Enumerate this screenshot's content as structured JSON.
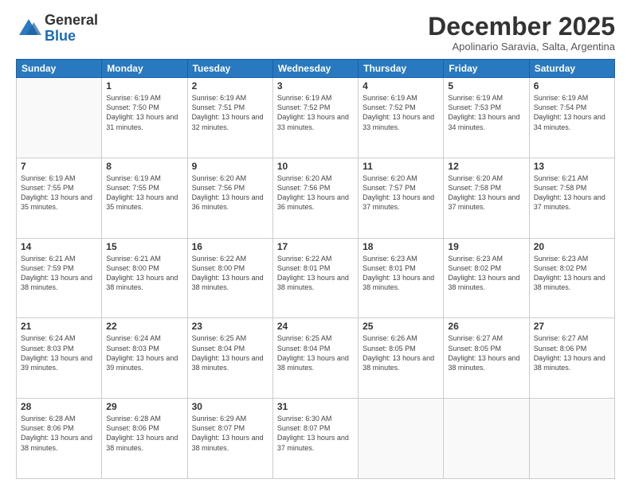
{
  "logo": {
    "general": "General",
    "blue": "Blue"
  },
  "title": "December 2025",
  "subtitle": "Apolinario Saravia, Salta, Argentina",
  "days_of_week": [
    "Sunday",
    "Monday",
    "Tuesday",
    "Wednesday",
    "Thursday",
    "Friday",
    "Saturday"
  ],
  "weeks": [
    [
      {
        "day": "",
        "info": ""
      },
      {
        "day": "1",
        "info": "Sunrise: 6:19 AM\nSunset: 7:50 PM\nDaylight: 13 hours and 31 minutes."
      },
      {
        "day": "2",
        "info": "Sunrise: 6:19 AM\nSunset: 7:51 PM\nDaylight: 13 hours and 32 minutes."
      },
      {
        "day": "3",
        "info": "Sunrise: 6:19 AM\nSunset: 7:52 PM\nDaylight: 13 hours and 33 minutes."
      },
      {
        "day": "4",
        "info": "Sunrise: 6:19 AM\nSunset: 7:52 PM\nDaylight: 13 hours and 33 minutes."
      },
      {
        "day": "5",
        "info": "Sunrise: 6:19 AM\nSunset: 7:53 PM\nDaylight: 13 hours and 34 minutes."
      },
      {
        "day": "6",
        "info": "Sunrise: 6:19 AM\nSunset: 7:54 PM\nDaylight: 13 hours and 34 minutes."
      }
    ],
    [
      {
        "day": "7",
        "info": "Sunrise: 6:19 AM\nSunset: 7:55 PM\nDaylight: 13 hours and 35 minutes."
      },
      {
        "day": "8",
        "info": "Sunrise: 6:19 AM\nSunset: 7:55 PM\nDaylight: 13 hours and 35 minutes."
      },
      {
        "day": "9",
        "info": "Sunrise: 6:20 AM\nSunset: 7:56 PM\nDaylight: 13 hours and 36 minutes."
      },
      {
        "day": "10",
        "info": "Sunrise: 6:20 AM\nSunset: 7:56 PM\nDaylight: 13 hours and 36 minutes."
      },
      {
        "day": "11",
        "info": "Sunrise: 6:20 AM\nSunset: 7:57 PM\nDaylight: 13 hours and 37 minutes."
      },
      {
        "day": "12",
        "info": "Sunrise: 6:20 AM\nSunset: 7:58 PM\nDaylight: 13 hours and 37 minutes."
      },
      {
        "day": "13",
        "info": "Sunrise: 6:21 AM\nSunset: 7:58 PM\nDaylight: 13 hours and 37 minutes."
      }
    ],
    [
      {
        "day": "14",
        "info": "Sunrise: 6:21 AM\nSunset: 7:59 PM\nDaylight: 13 hours and 38 minutes."
      },
      {
        "day": "15",
        "info": "Sunrise: 6:21 AM\nSunset: 8:00 PM\nDaylight: 13 hours and 38 minutes."
      },
      {
        "day": "16",
        "info": "Sunrise: 6:22 AM\nSunset: 8:00 PM\nDaylight: 13 hours and 38 minutes."
      },
      {
        "day": "17",
        "info": "Sunrise: 6:22 AM\nSunset: 8:01 PM\nDaylight: 13 hours and 38 minutes."
      },
      {
        "day": "18",
        "info": "Sunrise: 6:23 AM\nSunset: 8:01 PM\nDaylight: 13 hours and 38 minutes."
      },
      {
        "day": "19",
        "info": "Sunrise: 6:23 AM\nSunset: 8:02 PM\nDaylight: 13 hours and 38 minutes."
      },
      {
        "day": "20",
        "info": "Sunrise: 6:23 AM\nSunset: 8:02 PM\nDaylight: 13 hours and 38 minutes."
      }
    ],
    [
      {
        "day": "21",
        "info": "Sunrise: 6:24 AM\nSunset: 8:03 PM\nDaylight: 13 hours and 39 minutes."
      },
      {
        "day": "22",
        "info": "Sunrise: 6:24 AM\nSunset: 8:03 PM\nDaylight: 13 hours and 39 minutes."
      },
      {
        "day": "23",
        "info": "Sunrise: 6:25 AM\nSunset: 8:04 PM\nDaylight: 13 hours and 38 minutes."
      },
      {
        "day": "24",
        "info": "Sunrise: 6:25 AM\nSunset: 8:04 PM\nDaylight: 13 hours and 38 minutes."
      },
      {
        "day": "25",
        "info": "Sunrise: 6:26 AM\nSunset: 8:05 PM\nDaylight: 13 hours and 38 minutes."
      },
      {
        "day": "26",
        "info": "Sunrise: 6:27 AM\nSunset: 8:05 PM\nDaylight: 13 hours and 38 minutes."
      },
      {
        "day": "27",
        "info": "Sunrise: 6:27 AM\nSunset: 8:06 PM\nDaylight: 13 hours and 38 minutes."
      }
    ],
    [
      {
        "day": "28",
        "info": "Sunrise: 6:28 AM\nSunset: 8:06 PM\nDaylight: 13 hours and 38 minutes."
      },
      {
        "day": "29",
        "info": "Sunrise: 6:28 AM\nSunset: 8:06 PM\nDaylight: 13 hours and 38 minutes."
      },
      {
        "day": "30",
        "info": "Sunrise: 6:29 AM\nSunset: 8:07 PM\nDaylight: 13 hours and 38 minutes."
      },
      {
        "day": "31",
        "info": "Sunrise: 6:30 AM\nSunset: 8:07 PM\nDaylight: 13 hours and 37 minutes."
      },
      {
        "day": "",
        "info": ""
      },
      {
        "day": "",
        "info": ""
      },
      {
        "day": "",
        "info": ""
      }
    ]
  ]
}
